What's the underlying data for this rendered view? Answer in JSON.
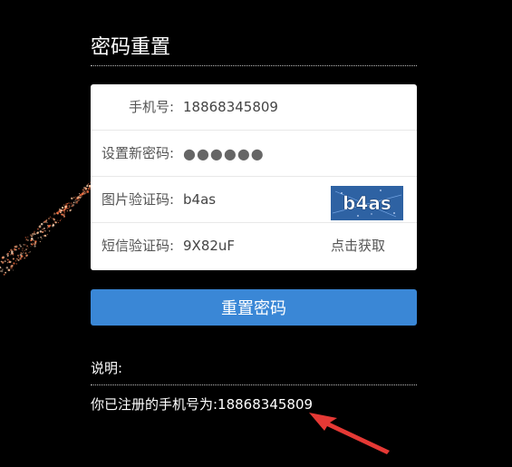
{
  "page": {
    "title": "密码重置"
  },
  "form": {
    "phone": {
      "label": "手机号:",
      "value": "18868345809"
    },
    "new_password": {
      "label": "设置新密码:",
      "value": "●●●●●●"
    },
    "image_captcha": {
      "label": "图片验证码:",
      "value": "b4as",
      "image_text": "b4as"
    },
    "sms_code": {
      "label": "短信验证码:",
      "value": "9X82uF",
      "button_label": "点击获取"
    }
  },
  "actions": {
    "submit_label": "重置密码"
  },
  "notes": {
    "heading": "说明:",
    "text": "你已注册的手机号为:18868345809"
  },
  "colors": {
    "background": "#000000",
    "button": "#3a87d6",
    "captcha_bg": "#2e62a3",
    "annotation_arrow": "#e53935"
  }
}
